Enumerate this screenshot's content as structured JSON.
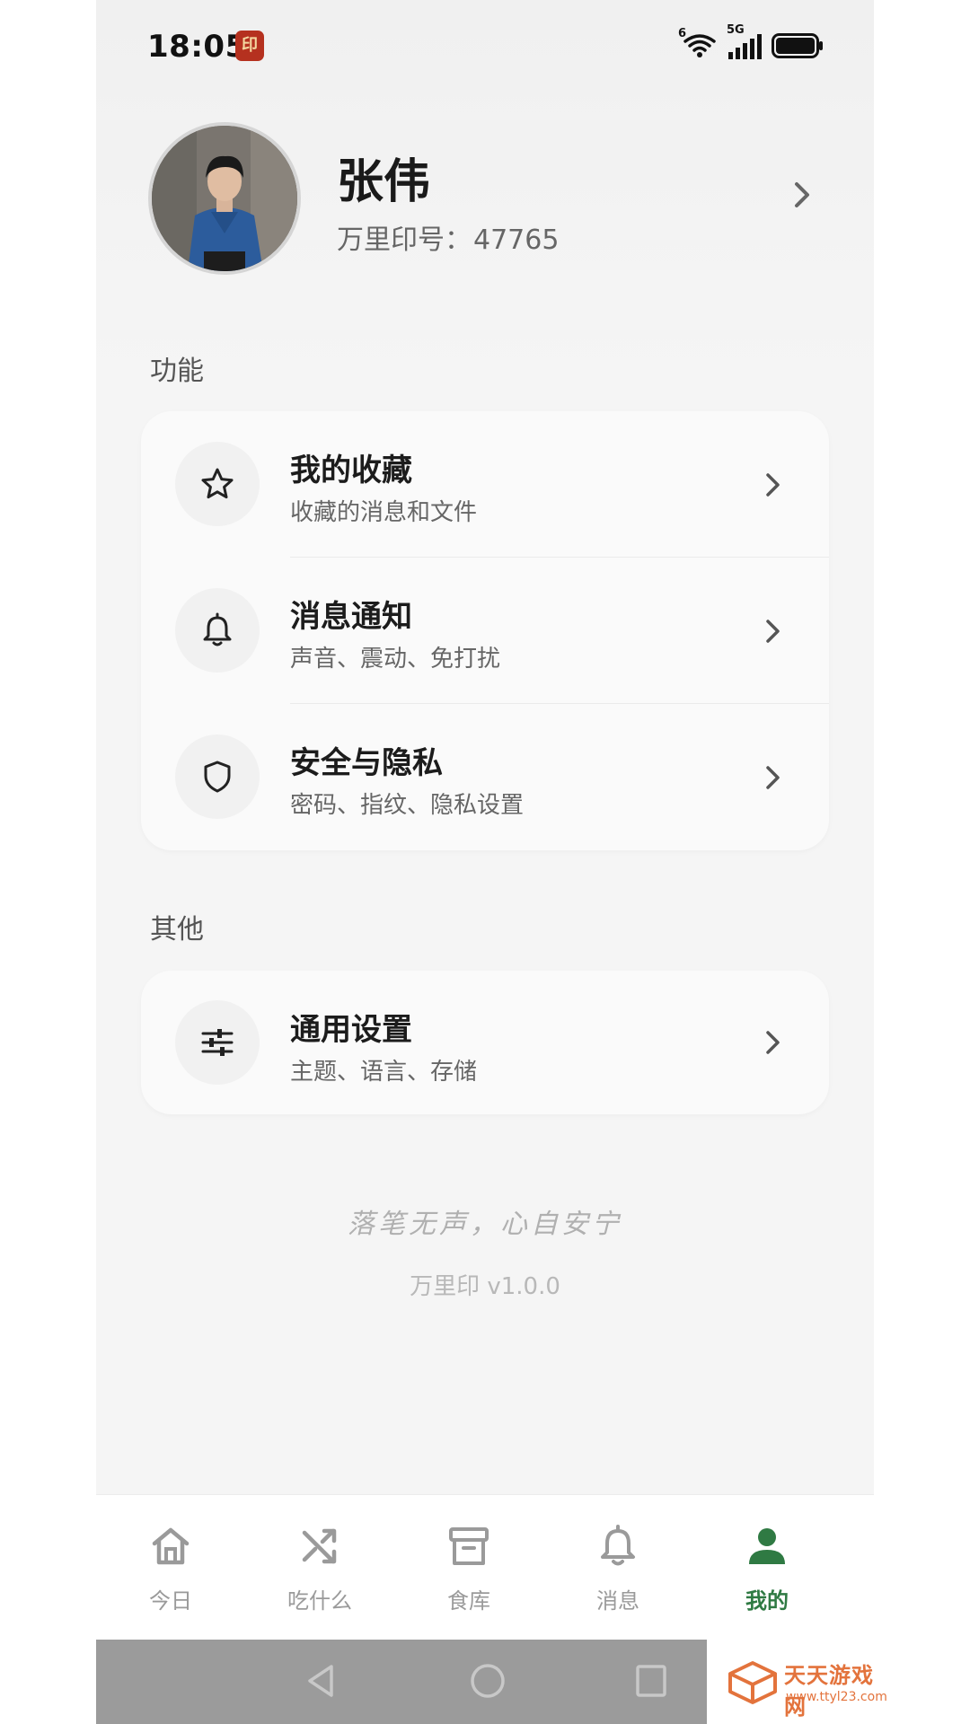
{
  "status_bar": {
    "time": "18:05",
    "app_badge_glyph": "印",
    "signal_label": "5G",
    "wifi_label": "6"
  },
  "profile": {
    "name": "张伟",
    "id_label": "万里印号：",
    "id_value": "47765"
  },
  "sections": {
    "features_label": "功能",
    "others_label": "其他"
  },
  "features": [
    {
      "title": "我的收藏",
      "subtitle": "收藏的消息和文件",
      "icon": "star-icon"
    },
    {
      "title": "消息通知",
      "subtitle": "声音、震动、免打扰",
      "icon": "bell-icon"
    },
    {
      "title": "安全与隐私",
      "subtitle": "密码、指纹、隐私设置",
      "icon": "shield-icon"
    }
  ],
  "others": [
    {
      "title": "通用设置",
      "subtitle": "主题、语言、存储",
      "icon": "sliders-icon"
    }
  ],
  "footer": {
    "motto": "落笔无声，心自安宁",
    "version": "万里印 v1.0.0"
  },
  "tabs": [
    {
      "label": "今日",
      "icon": "home-icon",
      "active": false
    },
    {
      "label": "吃什么",
      "icon": "shuffle-icon",
      "active": false
    },
    {
      "label": "食库",
      "icon": "archive-icon",
      "active": false
    },
    {
      "label": "消息",
      "icon": "bell-icon",
      "active": false
    },
    {
      "label": "我的",
      "icon": "person-icon",
      "active": true
    }
  ],
  "watermark": {
    "brand": "天天游戏网",
    "url": "www.ttyl23.com"
  },
  "colors": {
    "accent": "#2f7a43",
    "page_bg": "#f5f5f5",
    "card_bg": "#fafafa",
    "muted_text": "#9a9a9a"
  }
}
